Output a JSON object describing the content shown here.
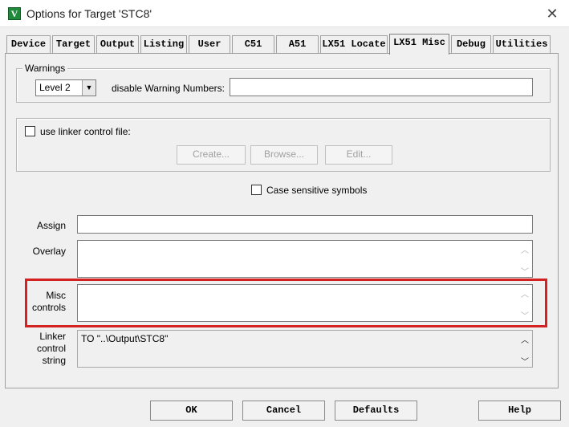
{
  "window": {
    "title": "Options for Target 'STC8'",
    "icon_letter": "V",
    "close_glyph": "✕"
  },
  "tabs": [
    {
      "label": "Device"
    },
    {
      "label": "Target"
    },
    {
      "label": "Output"
    },
    {
      "label": "Listing"
    },
    {
      "label": "User"
    },
    {
      "label": "C51"
    },
    {
      "label": "A51"
    },
    {
      "label": "LX51 Locate"
    },
    {
      "label": "LX51 Misc",
      "active": true
    },
    {
      "label": "Debug"
    },
    {
      "label": "Utilities"
    }
  ],
  "warnings": {
    "group_label": "Warnings",
    "level_value": "Level 2",
    "disable_label": "disable Warning Numbers:",
    "disable_value": ""
  },
  "linker_file": {
    "checkbox_label": "use linker control file:",
    "checked": false,
    "create_label": "Create...",
    "browse_label": "Browse...",
    "edit_label": "Edit..."
  },
  "case_sensitive": {
    "label": "Case sensitive symbols",
    "checked": false
  },
  "assign": {
    "label": "Assign",
    "value": ""
  },
  "overlay": {
    "label": "Overlay",
    "value": ""
  },
  "misc": {
    "label_line1": "Misc",
    "label_line2": "controls",
    "value": ""
  },
  "linker_string": {
    "label_line1": "Linker",
    "label_line2": "control",
    "label_line3": "string",
    "value": "TO \"..\\Output\\STC8\""
  },
  "footer": {
    "ok": "OK",
    "cancel": "Cancel",
    "defaults": "Defaults",
    "help": "Help"
  },
  "colors": {
    "highlight": "#d42222",
    "icon_green": "#1f8a3a"
  }
}
